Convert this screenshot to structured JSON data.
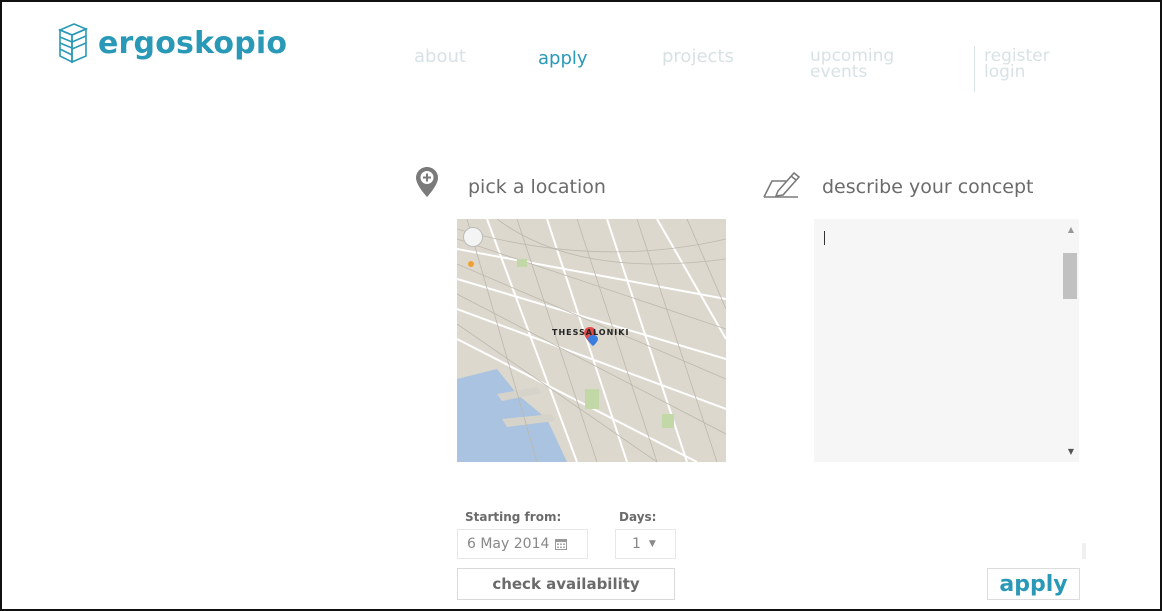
{
  "brand": {
    "name": "ergoskopio",
    "color": "#2a99b7"
  },
  "nav": {
    "about": "about",
    "apply": "apply",
    "projects": "projects",
    "upcoming_line1": "upcoming",
    "upcoming_line2": "events",
    "register": "register",
    "login": "login"
  },
  "location": {
    "title": "pick a location",
    "icon": "map-pin-icon",
    "map_label": "THESSALONIKI"
  },
  "concept": {
    "title": "describe your concept",
    "icon": "pencil-icon",
    "text": ""
  },
  "booking": {
    "start_label": "Starting from:",
    "start_value": "6 May 2014",
    "days_label": "Days:",
    "days_value": "1",
    "check_label": "check availability"
  },
  "apply_button": "apply"
}
